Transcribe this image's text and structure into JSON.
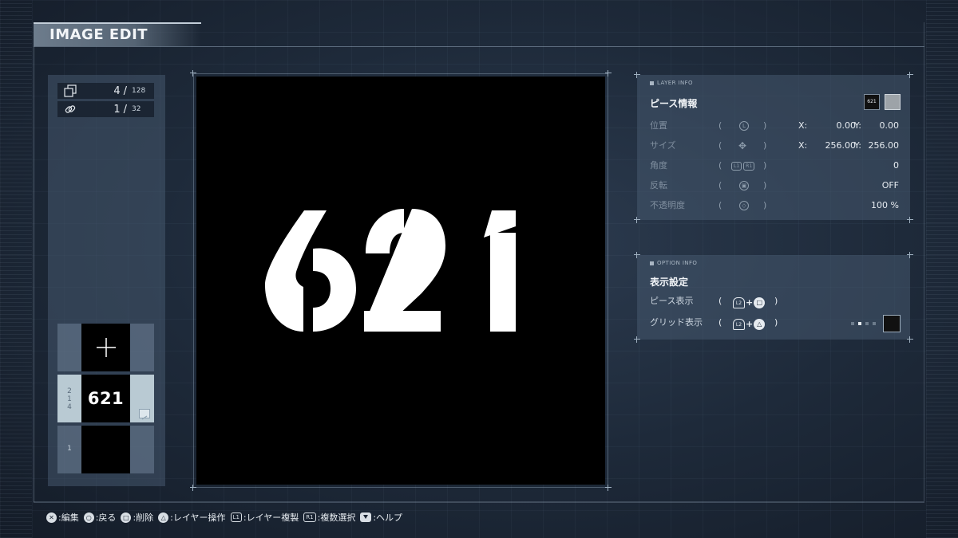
{
  "header": {
    "title": "IMAGE EDIT"
  },
  "counters": {
    "layers": {
      "icon": "layers-icon",
      "current": "4",
      "separator": "/",
      "max": "128"
    },
    "links": {
      "icon": "link-icon",
      "current": "1",
      "separator": "/",
      "max": "32"
    }
  },
  "layer_list": {
    "add_icon": "plus-icon",
    "items": [
      {
        "side_label": "2\n1\n4",
        "thumb_text": "621",
        "selected": true,
        "linked": true
      },
      {
        "side_label": "1",
        "thumb_text": "",
        "selected": false,
        "linked": false
      }
    ]
  },
  "canvas": {
    "piece_text": "621",
    "background": "#000000",
    "foreground": "#ffffff"
  },
  "layer_info": {
    "header": "LAYER INFO",
    "title": "ピース情報",
    "piece_thumb": "621",
    "color_swatch": "#9da3a8",
    "rows": [
      {
        "label": "位置",
        "control": "L",
        "x_label": "X:",
        "x_value": "0.00",
        "y_label": "Y:",
        "y_value": "0.00"
      },
      {
        "label": "サイズ",
        "control": "✥",
        "x_label": "X:",
        "x_value": "256.00",
        "y_label": "Y:",
        "y_value": "256.00"
      },
      {
        "label": "角度",
        "control_chips": [
          "L1",
          "R1"
        ],
        "value": "0"
      },
      {
        "label": "反転",
        "control": "▣",
        "value": "OFF"
      },
      {
        "label": "不透明度",
        "control": "◇",
        "value": "100 %"
      }
    ]
  },
  "option_info": {
    "header": "OPTION INFO",
    "title": "表示設定",
    "rows": [
      {
        "label": "ピース表示",
        "combo_left": "L2",
        "combo_right": "□"
      },
      {
        "label": "グリッド表示",
        "combo_left": "L2",
        "combo_right": "△"
      }
    ]
  },
  "help_bar": [
    {
      "button": "✕",
      "text": ":編集"
    },
    {
      "button": "○",
      "text": ":戻る"
    },
    {
      "button": "□",
      "text": ":削除"
    },
    {
      "button": "△",
      "text": ":レイヤー操作"
    },
    {
      "chip": "L1",
      "text": ":レイヤー複製"
    },
    {
      "chip": "R1",
      "text": ":複数選択"
    },
    {
      "down": true,
      "text": ":ヘルプ"
    }
  ],
  "colors": {
    "accent": "#c3ced9",
    "panel": "#465870"
  }
}
